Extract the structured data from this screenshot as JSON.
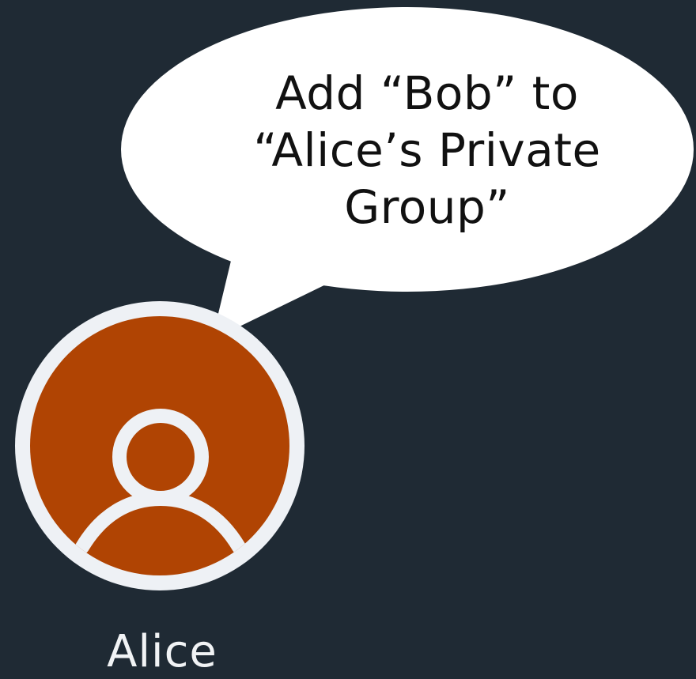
{
  "speech_bubble": {
    "lines": [
      "Add “Bob” to",
      "“Alice’s Private",
      "Group”"
    ]
  },
  "user": {
    "name": "Alice",
    "avatar_icon": "user-icon"
  },
  "colors": {
    "background": "#1f2a34",
    "avatar_fill": "#b04403",
    "avatar_ring": "#eef1f5",
    "bubble_fill": "#ffffff",
    "label_text": "#f1f3f5"
  }
}
